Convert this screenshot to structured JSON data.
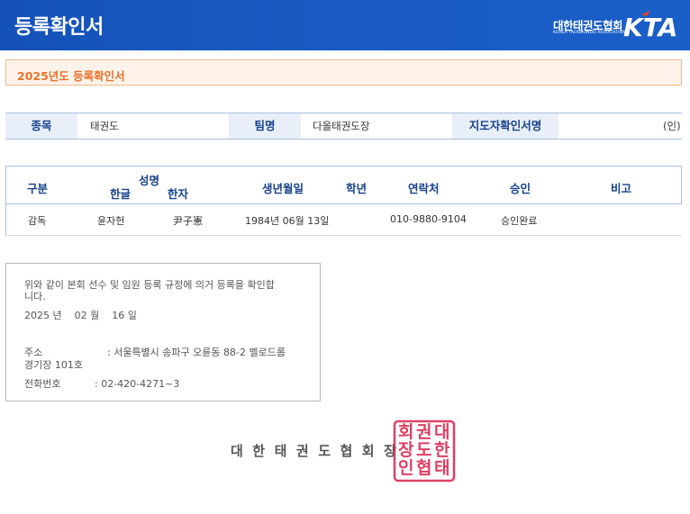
{
  "header": {
    "title": "등록확인서",
    "logo_korean": "대한태권도협회",
    "logo_english": "KOREA TAEKWONDO ASSOCIATION",
    "logo_letters": "KTA"
  },
  "doc_title": "2025년도 등록확인서",
  "info": {
    "sport_label": "종목",
    "sport_value": "태권도",
    "team_label": "팀명",
    "team_value": "다올태권도장",
    "coach_label": "지도자확인서명",
    "coach_value": "(인)"
  },
  "table": {
    "headers": {
      "category": "구분",
      "name": "성명",
      "name_hangul": "한글",
      "name_hanja": "한자",
      "birth": "생년월일",
      "grade": "학년",
      "contact": "연락처",
      "approval": "승인",
      "note": "비고"
    },
    "rows": [
      {
        "category": "감독",
        "name_hangul": "윤자헌",
        "name_hanja": "尹子憲",
        "birth": "1984년 06월 13일",
        "grade": "",
        "contact": "010-9880-9104",
        "approval": "승인완료",
        "note": ""
      }
    ]
  },
  "confirm": {
    "statement_line1": "위와 같이 본회 선수 및 임원 등록 규정에 의거 등록을 확인합",
    "statement_line2": "니다.",
    "date": "2025 년    02 월    16 일",
    "address_label": "주소",
    "address_line1": ": 서울특별시 송파구 오륜동 88-2 벨로드롬",
    "address_line2": "경기장 101호",
    "phone_label": "전화번호",
    "phone_value": ": 02-420-4271~3"
  },
  "signature": {
    "association_name": "대한태권도협회장",
    "seal_chars": [
      "대",
      "한",
      "태",
      "권",
      "도",
      "협",
      "회",
      "장",
      "인"
    ],
    "seal_color": "#d81e4a"
  },
  "colors": {
    "header_blue": "#1a5cc4",
    "label_blue": "#16418a",
    "orange": "#e8722a"
  }
}
